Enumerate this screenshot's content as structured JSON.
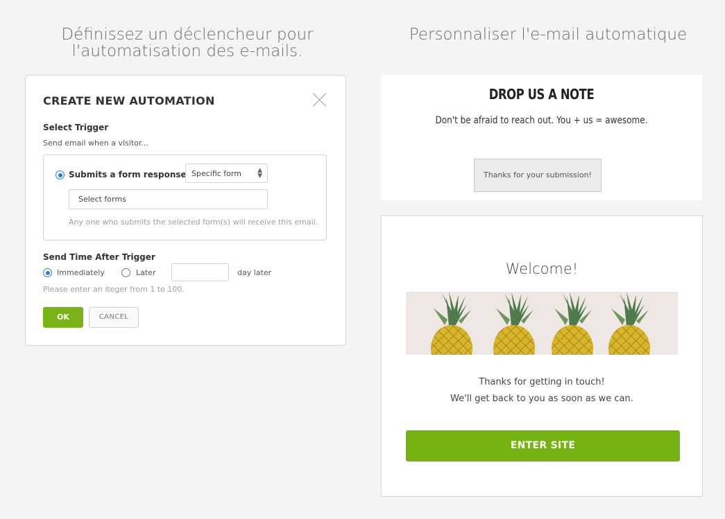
{
  "headings": {
    "left": "Définissez un déclencheur pour l'automatisation des e-mails.",
    "right": "Personnaliser l'e-mail automatique"
  },
  "modal": {
    "title": "CREATE NEW AUTOMATION",
    "select_trigger_label": "Select Trigger",
    "send_when": "Send email when a visitor...",
    "trigger_option": "Submits a form response to",
    "form_select_value": "Specific form",
    "forms_input_value": "Select forms",
    "forms_hint": "Any one who submits the selected form(s) will receive this email.",
    "send_time_label": "Send Time After Trigger",
    "immediately_label": "Immediately",
    "later_label": "Later",
    "day_later_label": "day later",
    "integer_hint": "Please enter an iteger  from 1 to 100.",
    "ok_label": "OK",
    "cancel_label": "CANCEL",
    "accent_color": "#7ab317",
    "radio_color": "#2d7be0"
  },
  "note_preview": {
    "title": "DROP US A NOTE",
    "subtitle": "Don't be afraid to reach out. You + us = awesome.",
    "button_label": "Thanks for your submission!"
  },
  "email_preview": {
    "title": "Welcome!",
    "banner_icon": "pineapple-icon",
    "line1": "Thanks for getting in touch!",
    "line2": "We'll get back to you as soon as we can.",
    "cta_label": "ENTER SITE",
    "cta_color": "#74b312"
  }
}
